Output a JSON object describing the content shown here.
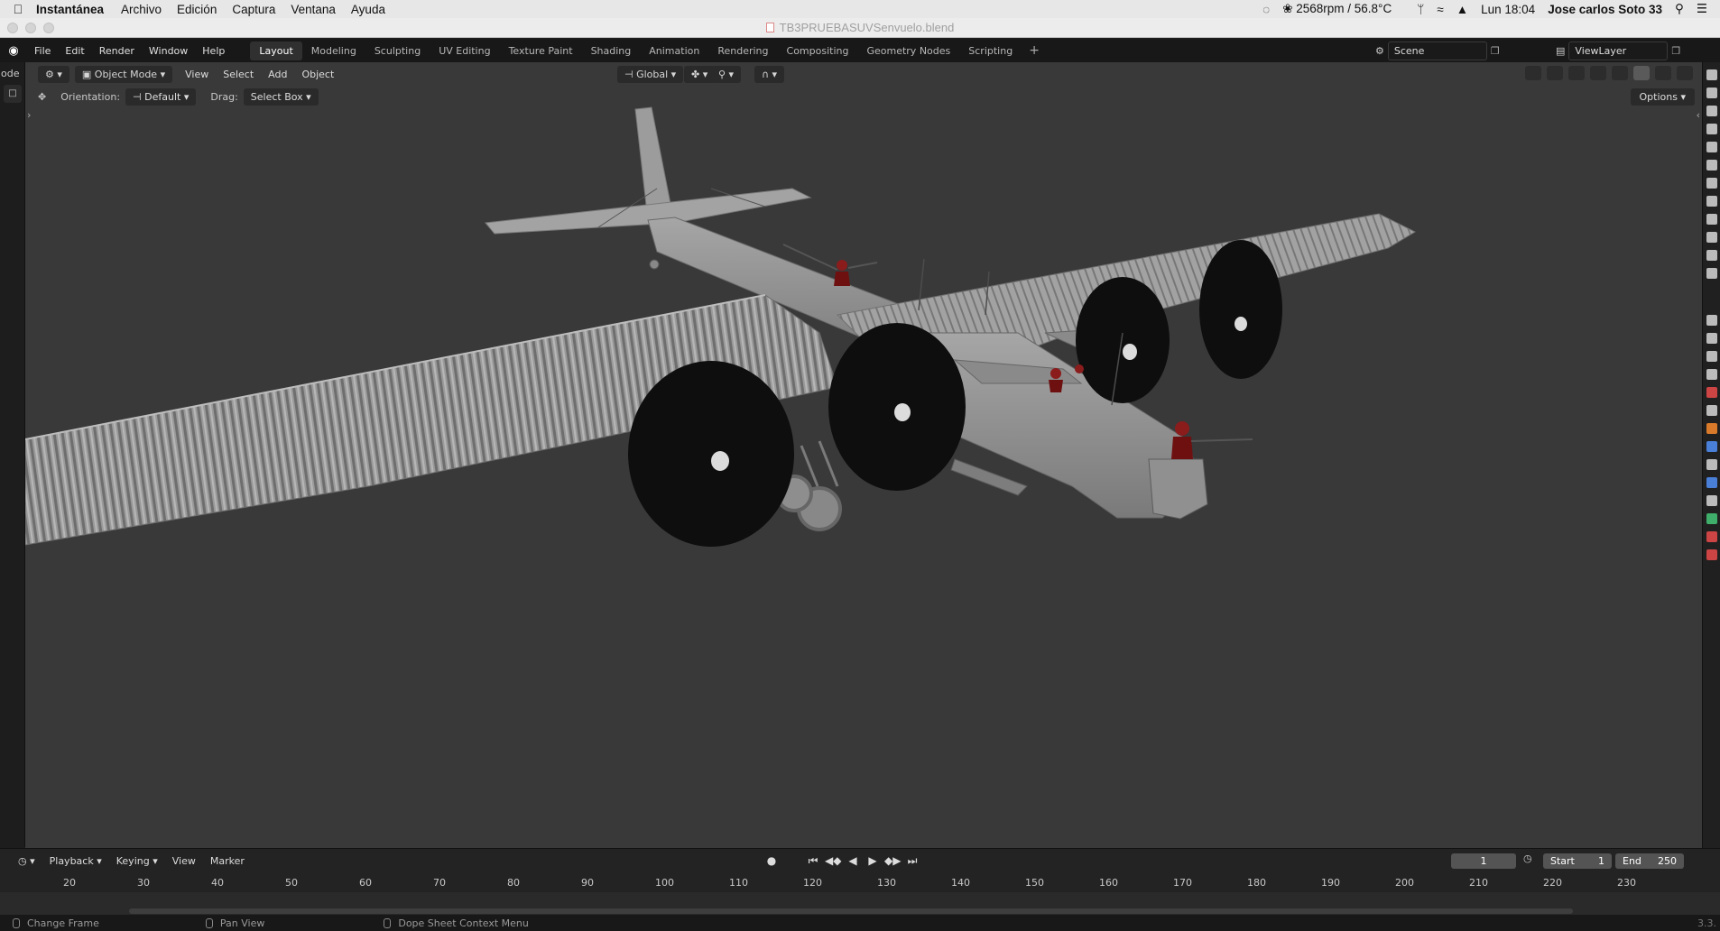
{
  "mac": {
    "app_name": "Instantánea",
    "menu": [
      "Archivo",
      "Edición",
      "Captura",
      "Ventana",
      "Ayuda"
    ],
    "fan": "2568rpm / 56.8°C",
    "clock": "Lun 18:04",
    "user": "Jose carlos Soto 33"
  },
  "window": {
    "title": "TB3PRUEBASUVSenvuelo.blend"
  },
  "topbar": {
    "menus": [
      "File",
      "Edit",
      "Render",
      "Window",
      "Help"
    ],
    "workspaces": [
      "Layout",
      "Modeling",
      "Sculpting",
      "UV Editing",
      "Texture Paint",
      "Shading",
      "Animation",
      "Rendering",
      "Compositing",
      "Geometry Nodes",
      "Scripting"
    ],
    "active_workspace": "Layout",
    "scene": "Scene",
    "view_layer": "ViewLayer"
  },
  "viewport": {
    "left_cut_label": "ode",
    "mode": "Object Mode",
    "menus": [
      "View",
      "Select",
      "Add",
      "Object"
    ],
    "transform_orientation": "Global",
    "orientation_label": "Orientation:",
    "orientation_value": "Default",
    "drag_label": "Drag:",
    "drag_value": "Select Box",
    "options_label": "Options"
  },
  "timeline": {
    "menus": [
      "Playback",
      "Keying",
      "View",
      "Marker"
    ],
    "current_frame": "1",
    "start_label": "Start",
    "start_value": "1",
    "end_label": "End",
    "end_value": "250",
    "ticks": [
      "20",
      "30",
      "40",
      "50",
      "60",
      "70",
      "80",
      "90",
      "100",
      "110",
      "120",
      "130",
      "140",
      "150",
      "160",
      "170",
      "180",
      "190",
      "200",
      "210",
      "220",
      "230"
    ]
  },
  "statusbar": {
    "hints": [
      "Change Frame",
      "Pan View",
      "Dope Sheet Context Menu"
    ],
    "version": "3.3."
  }
}
